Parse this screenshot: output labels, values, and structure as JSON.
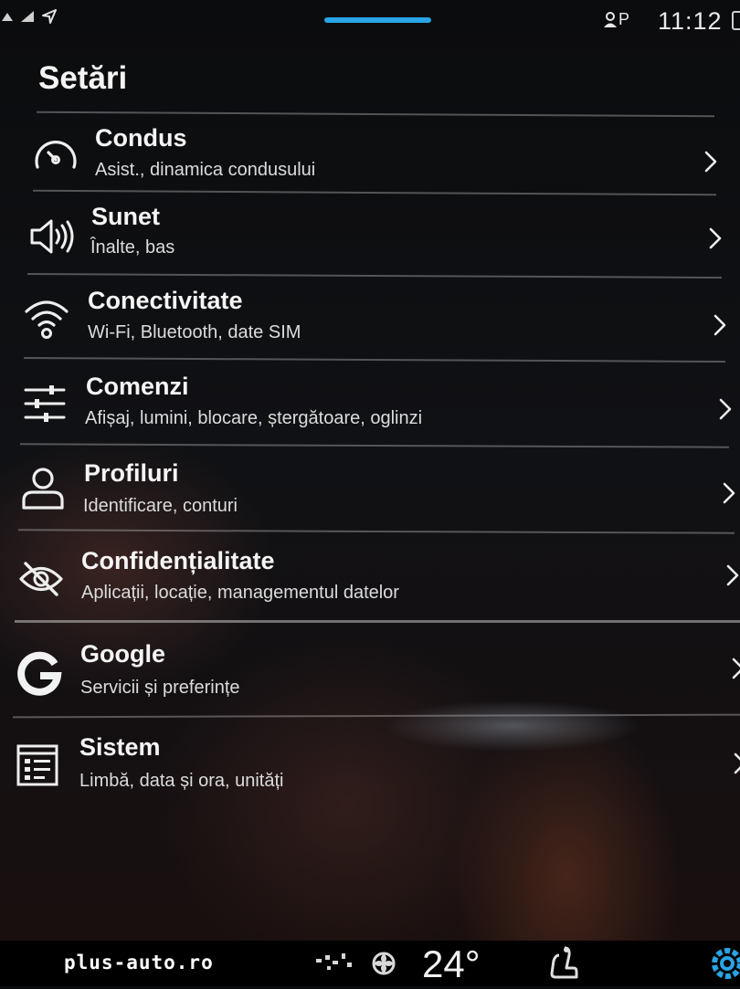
{
  "status": {
    "profile_indicator": "P",
    "time": "11:12"
  },
  "page_title": "Setări",
  "menu": [
    {
      "title": "Condus",
      "subtitle": "Asist., dinamica condusului",
      "icon": "speedometer-icon"
    },
    {
      "title": "Sunet",
      "subtitle": "Înalte, bas",
      "icon": "speaker-icon"
    },
    {
      "title": "Conectivitate",
      "subtitle": "Wi-Fi, Bluetooth, date SIM",
      "icon": "wifi-icon"
    },
    {
      "title": "Comenzi",
      "subtitle": "Afișaj, lumini, blocare, ștergătoare, oglinzi",
      "icon": "sliders-icon"
    },
    {
      "title": "Profiluri",
      "subtitle": "Identificare, conturi",
      "icon": "user-icon"
    },
    {
      "title": "Confidențialitate",
      "subtitle": "Aplicații, locație, managementul datelor",
      "icon": "eye-off-icon"
    },
    {
      "title": "Google",
      "subtitle": "Servicii și preferințe",
      "icon": "google-icon"
    },
    {
      "title": "Sistem",
      "subtitle": "Limbă, data și ora, unități",
      "icon": "system-icon"
    }
  ],
  "bottom_bar": {
    "watermark": "plus-auto.ro",
    "temperature": "24°"
  },
  "colors": {
    "accent": "#29a4e6",
    "background": "#0a0b0d",
    "text": "#f2f2f2"
  }
}
